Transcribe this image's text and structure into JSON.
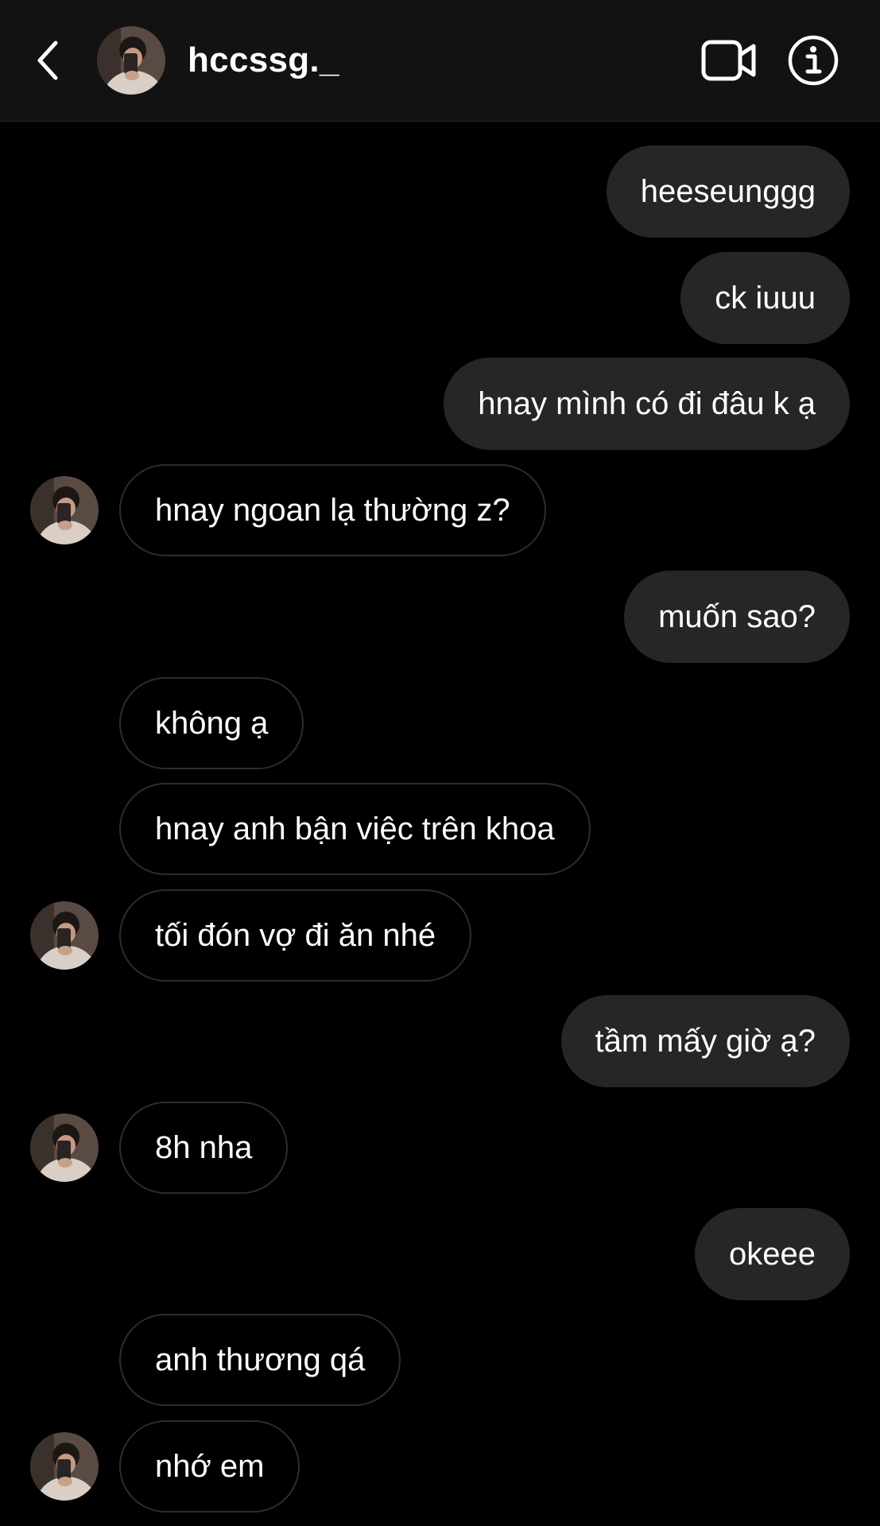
{
  "header": {
    "username": "hccssg._",
    "icons": {
      "back": "chevron-left-icon",
      "video": "video-camera-icon",
      "info": "info-icon"
    }
  },
  "messages": [
    {
      "sender": "me",
      "text": "heeseunggg",
      "avatar": false
    },
    {
      "sender": "me",
      "text": "ck iuuu",
      "avatar": false
    },
    {
      "sender": "me",
      "text": "hnay mình có đi đâu k ạ",
      "avatar": false
    },
    {
      "sender": "them",
      "text": "hnay ngoan lạ thường z?",
      "avatar": true
    },
    {
      "sender": "me",
      "text": "muốn sao?",
      "avatar": false
    },
    {
      "sender": "them",
      "text": "không ạ",
      "avatar": false
    },
    {
      "sender": "them",
      "text": "hnay anh bận việc trên khoa",
      "avatar": false
    },
    {
      "sender": "them",
      "text": "tối đón vợ đi ăn nhé",
      "avatar": true
    },
    {
      "sender": "me",
      "text": "tầm mấy giờ ạ?",
      "avatar": false
    },
    {
      "sender": "them",
      "text": "8h nha",
      "avatar": true
    },
    {
      "sender": "me",
      "text": "okeee",
      "avatar": false
    },
    {
      "sender": "them",
      "text": "anh thương qá",
      "avatar": false
    },
    {
      "sender": "them",
      "text": "nhớ em",
      "avatar": true
    }
  ],
  "colors": {
    "background": "#000000",
    "header": "#121212",
    "outgoing_bubble": "#262626",
    "incoming_border": "#2d2d2d",
    "text": "#ffffff"
  }
}
